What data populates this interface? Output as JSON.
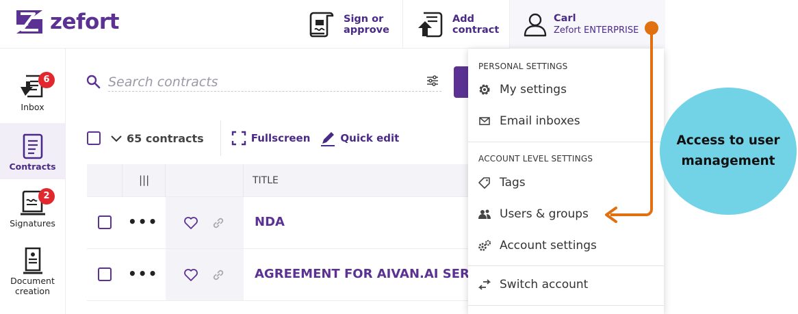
{
  "brand": {
    "name": "zefort"
  },
  "header": {
    "sign_label_1": "Sign or",
    "sign_label_2": "approve",
    "add_label_1": "Add",
    "add_label_2": "contract",
    "user_name": "Carl",
    "user_org": "Zefort ENTERPRISE"
  },
  "sidebar": {
    "items": [
      {
        "label": "Inbox",
        "badge": "6"
      },
      {
        "label": "Contracts"
      },
      {
        "label": "Signatures",
        "badge": "2"
      },
      {
        "label_1": "Document",
        "label_2": "creation"
      }
    ]
  },
  "search": {
    "placeholder": "Search contracts"
  },
  "toolbar": {
    "count": "65 contracts",
    "fullscreen": "Fullscreen",
    "quick_edit": "Quick edit"
  },
  "table": {
    "columns": {
      "title": "TITLE",
      "handle": "|||"
    },
    "rows": [
      {
        "title": "NDA",
        "dots": "•••"
      },
      {
        "title": "AGREEMENT FOR AIVAN.AI SERVICES",
        "dots": "•••"
      }
    ]
  },
  "menu": {
    "personal_heading": "PERSONAL SETTINGS",
    "my_settings": "My settings",
    "email_inboxes": "Email inboxes",
    "account_heading": "ACCOUNT LEVEL SETTINGS",
    "tags": "Tags",
    "users_groups": "Users & groups",
    "account_settings": "Account settings",
    "switch_account": "Switch account"
  },
  "annotation": {
    "line_1": "Access to user",
    "line_2": "management",
    "arrow_color": "#e07010",
    "bubble_color": "#72d2e6"
  },
  "colors": {
    "brand": "#5b3293",
    "badge": "#e0282e"
  }
}
